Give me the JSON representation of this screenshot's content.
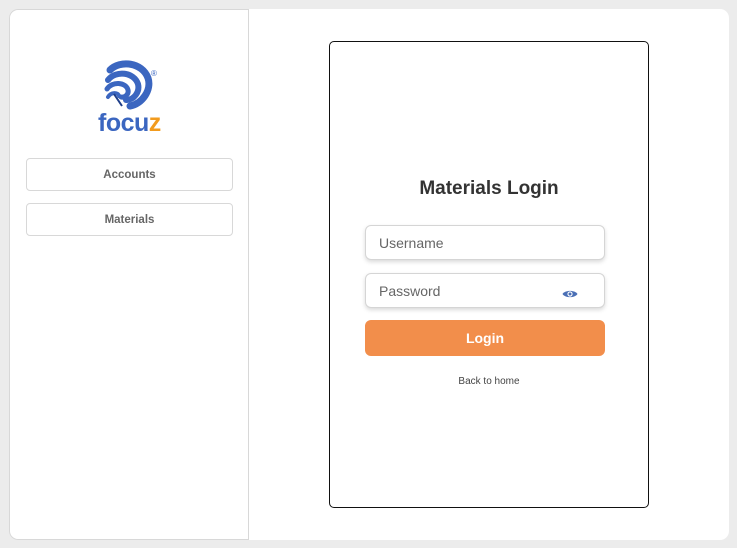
{
  "logo": {
    "text_part1": "focu",
    "text_part2": "z",
    "registered_mark": "®",
    "brand_blue": "#3b66c0",
    "brand_orange": "#f29b1e"
  },
  "sidebar": {
    "items": [
      {
        "label": "Accounts"
      },
      {
        "label": "Materials"
      }
    ]
  },
  "login": {
    "title": "Materials Login",
    "username_placeholder": "Username",
    "password_placeholder": "Password",
    "password_toggle_icon": "eye-icon",
    "submit_label": "Login",
    "back_link": "Back to home",
    "accent_color": "#f28e4b"
  }
}
